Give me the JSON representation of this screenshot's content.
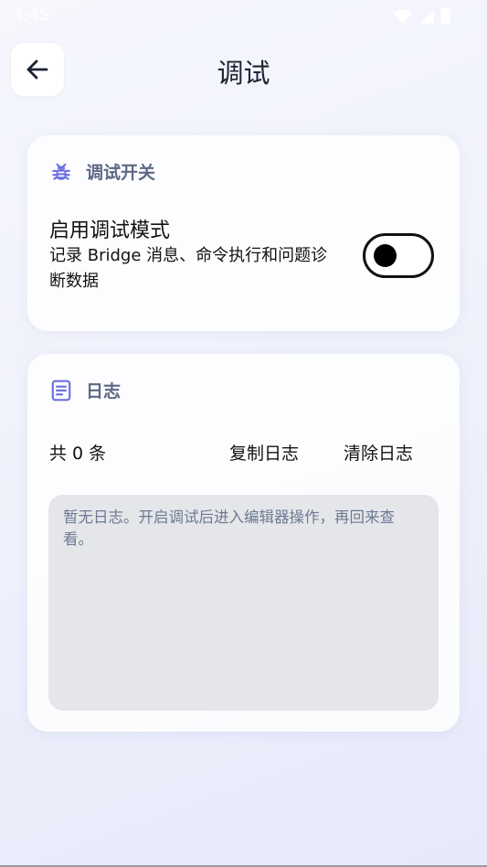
{
  "status_bar": {
    "time": "3:45"
  },
  "header": {
    "title": "调试"
  },
  "debug_section": {
    "title": "调试开关",
    "toggle_label": "启用调试模式",
    "toggle_description": "记录 Bridge 消息、命令执行和问题诊断数据",
    "enabled": false
  },
  "log_section": {
    "title": "日志",
    "count_text": "共 0 条",
    "copy_label": "复制日志",
    "clear_label": "清除日志",
    "empty_text": "暂无日志。开启调试后进入编辑器操作，再回来查看。"
  },
  "colors": {
    "accent": "#6b6fe0",
    "section_title": "#5d6885",
    "log_box_bg": "#e5e6e9"
  }
}
